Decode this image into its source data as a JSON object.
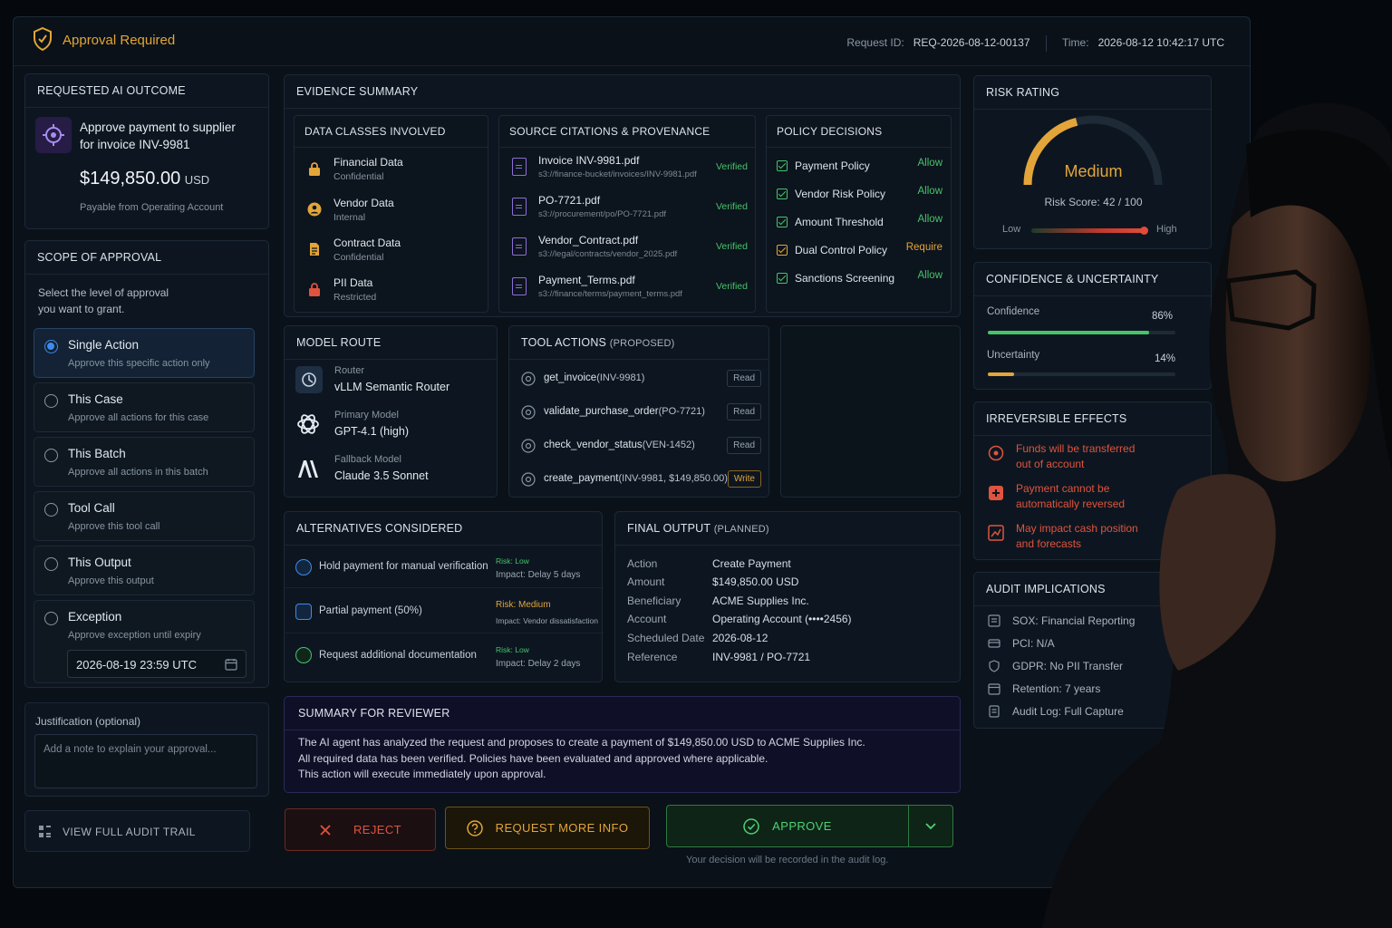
{
  "header": {
    "title": "Approval Required",
    "request_label": "Request ID:",
    "request_id": "REQ-2026-08-12-00137",
    "time_label": "Time:",
    "time": "2026-08-12 10:42:17 UTC"
  },
  "outcome": {
    "heading": "REQUESTED AI OUTCOME",
    "line1": "Approve payment to supplier",
    "line2": "for invoice INV-9981",
    "amount": "$149,850.00",
    "currency": "USD",
    "source": "Payable from Operating Account"
  },
  "scope": {
    "heading": "SCOPE OF APPROVAL",
    "intro1": "Select the level of approval",
    "intro2": "you want to grant.",
    "options": [
      {
        "title": "Single Action",
        "desc": "Approve this specific action only",
        "selected": true
      },
      {
        "title": "This Case",
        "desc": "Approve all actions for this case"
      },
      {
        "title": "This Batch",
        "desc": "Approve all actions in this batch"
      },
      {
        "title": "Tool Call",
        "desc": "Approve this tool call"
      },
      {
        "title": "This Output",
        "desc": "Approve this output"
      },
      {
        "title": "Exception",
        "desc": "Approve exception until expiry"
      }
    ],
    "expiry": "2026-08-19 23:59 UTC"
  },
  "justification": {
    "label": "Justification (optional)",
    "placeholder": "Add a note to explain your approval..."
  },
  "audit_trail_button": "VIEW FULL AUDIT TRAIL",
  "evidence": {
    "heading": "EVIDENCE SUMMARY",
    "data_classes": {
      "heading": "DATA CLASSES INVOLVED",
      "items": [
        {
          "name": "Financial Data",
          "level": "Confidential",
          "icon": "lock-icon"
        },
        {
          "name": "Vendor Data",
          "level": "Internal",
          "icon": "vendor-icon"
        },
        {
          "name": "Contract Data",
          "level": "Confidential",
          "icon": "document-icon"
        },
        {
          "name": "PII Data",
          "level": "Restricted",
          "icon": "lock-icon"
        }
      ]
    },
    "sources": {
      "heading": "SOURCE CITATIONS & PROVENANCE",
      "items": [
        {
          "file": "Invoice INV-9981.pdf",
          "path": "s3://finance-bucket/invoices/INV-9981.pdf",
          "status": "Verified"
        },
        {
          "file": "PO-7721.pdf",
          "path": "s3://procurement/po/PO-7721.pdf",
          "status": "Verified"
        },
        {
          "file": "Vendor_Contract.pdf",
          "path": "s3://legal/contracts/vendor_2025.pdf",
          "status": "Verified"
        },
        {
          "file": "Payment_Terms.pdf",
          "path": "s3://finance/terms/payment_terms.pdf",
          "status": "Verified"
        }
      ]
    },
    "policies": {
      "heading": "POLICY DECISIONS",
      "items": [
        {
          "name": "Payment Policy",
          "decision": "Allow"
        },
        {
          "name": "Vendor Risk Policy",
          "decision": "Allow"
        },
        {
          "name": "Amount Threshold",
          "decision": "Allow"
        },
        {
          "name": "Dual Control Policy",
          "decision": "Require"
        },
        {
          "name": "Sanctions Screening",
          "decision": "Allow"
        }
      ]
    }
  },
  "model_route": {
    "heading": "MODEL ROUTE",
    "items": [
      {
        "label": "Router",
        "value": "vLLM Semantic Router"
      },
      {
        "label": "Primary Model",
        "value": "GPT-4.1 (high)"
      },
      {
        "label": "Fallback Model",
        "value": "Claude 3.5 Sonnet"
      }
    ]
  },
  "tool_actions": {
    "heading": "TOOL ACTIONS",
    "heading_note": "(PROPOSED)",
    "items": [
      {
        "name": "get_invoice",
        "args": "(INV-9981)",
        "mode": "Read"
      },
      {
        "name": "validate_purchase_order",
        "args": "(PO-7721)",
        "mode": "Read"
      },
      {
        "name": "check_vendor_status",
        "args": "(VEN-1452)",
        "mode": "Read"
      },
      {
        "name": "create_payment",
        "args": "(INV-9981, $149,850.00)",
        "mode": "Write"
      }
    ]
  },
  "alternatives": {
    "heading": "ALTERNATIVES CONSIDERED",
    "items": [
      {
        "text": "Hold payment for manual verification",
        "risk": "Risk: Low",
        "impact": "Impact: Delay 5 days"
      },
      {
        "text": "Partial payment (50%)",
        "risk": "Risk: Medium",
        "impact": "Impact: Vendor dissatisfaction"
      },
      {
        "text": "Request additional documentation",
        "risk": "Risk: Low",
        "impact": "Impact: Delay 2 days"
      }
    ]
  },
  "final_output": {
    "heading": "FINAL OUTPUT",
    "heading_note": "(PLANNED)",
    "rows": [
      {
        "k": "Action",
        "v": "Create Payment"
      },
      {
        "k": "Amount",
        "v": "$149,850.00 USD"
      },
      {
        "k": "Beneficiary",
        "v": "ACME Supplies Inc."
      },
      {
        "k": "Account",
        "v": "Operating Account (••••2456)"
      },
      {
        "k": "Scheduled Date",
        "v": "2026-08-12"
      },
      {
        "k": "Reference",
        "v": "INV-9981 / PO-7721"
      }
    ]
  },
  "summary": {
    "heading": "SUMMARY FOR REVIEWER",
    "line1": "The AI agent has analyzed the request and proposes to create a payment of $149,850.00 USD to ACME Supplies Inc.",
    "line2": "All required data has been verified. Policies have been evaluated and approved where applicable.",
    "line3": "This action will execute immediately upon approval."
  },
  "actions": {
    "reject": "REJECT",
    "more_info": "REQUEST MORE INFO",
    "approve": "APPROVE",
    "note": "Your decision will be recorded in the audit log."
  },
  "risk": {
    "heading": "RISK RATING",
    "level": "Medium",
    "score_text": "Risk Score: 42 / 100",
    "score": 42,
    "low": "Low",
    "high": "High"
  },
  "confidence": {
    "heading": "CONFIDENCE & UNCERTAINTY",
    "confidence_label": "Confidence",
    "confidence_value": "86%",
    "confidence": 0.86,
    "uncertainty_label": "Uncertainty",
    "uncertainty_value": "14%",
    "uncertainty": 0.14
  },
  "irreversible": {
    "heading": "IRREVERSIBLE EFFECTS",
    "items": [
      {
        "l1": "Funds will be transferred",
        "l2": "out of account"
      },
      {
        "l1": "Payment cannot be",
        "l2": "automatically reversed"
      },
      {
        "l1": "May impact cash position",
        "l2": "and forecasts"
      }
    ]
  },
  "audit": {
    "heading": "AUDIT IMPLICATIONS",
    "items": [
      {
        "text": "SOX: Financial Reporting"
      },
      {
        "text": "PCI: N/A"
      },
      {
        "text": "GDPR: No PII Transfer"
      },
      {
        "text": "Retention: 7 years"
      },
      {
        "text": "Audit Log: Full Capture"
      }
    ]
  },
  "colors": {
    "accent": "#e4a632",
    "allow": "#46c46a",
    "require": "#e3a53a",
    "danger": "#e0533d",
    "select": "#3d8bf0"
  }
}
